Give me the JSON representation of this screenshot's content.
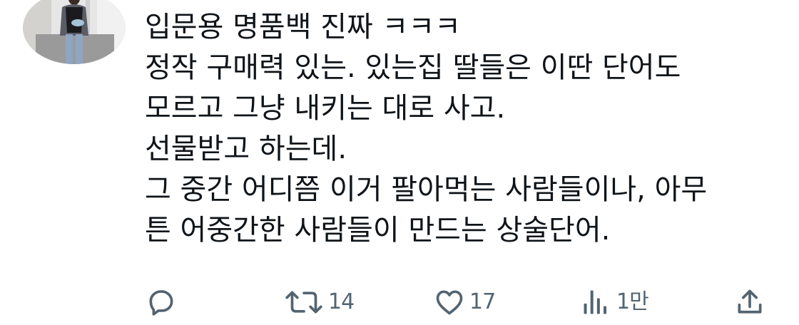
{
  "tweet": {
    "lines": [
      "입문용 명품백 진짜 ㅋㅋㅋ",
      "정작 구매력 있는. 있는집 딸들은 이딴 단어도",
      "모르고 그냥 내키는 대로 사고.",
      "선물받고 하는데.",
      "그 중간 어디쯤 이거 팔아먹는 사람들이나, 아무",
      "튼 어중간한 사람들이 만드는 상술단어."
    ]
  },
  "actions": {
    "reply": {
      "icon": "reply-icon",
      "count": ""
    },
    "retweet": {
      "icon": "retweet-icon",
      "count": "14"
    },
    "like": {
      "icon": "heart-icon",
      "count": "17"
    },
    "views": {
      "icon": "views-chart-icon",
      "count": "1만"
    },
    "share": {
      "icon": "share-icon",
      "count": ""
    }
  },
  "colors": {
    "text": "#0f1419",
    "icon": "#536471",
    "background": "#ffffff"
  }
}
